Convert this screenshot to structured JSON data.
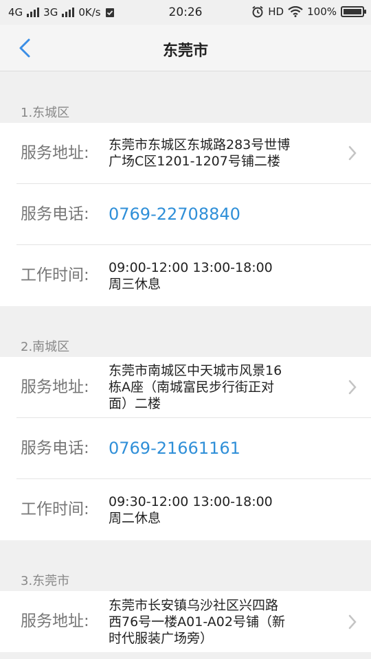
{
  "status_bar": {
    "signal_1": "4G",
    "signal_2": "3G",
    "speed": "0K/s",
    "time": "20:26",
    "hd": "HD",
    "battery": "100%"
  },
  "nav": {
    "title": "东莞市",
    "back_icon": "chevron-left-icon"
  },
  "sections": [
    {
      "heading": "1.东城区",
      "address_label": "服务地址:",
      "address_line1": "东莞市东城区东城路283号世博",
      "address_line2": "广场C区1201-1207号铺二楼",
      "phone_label": "服务电话:",
      "phone": "0769-22708840",
      "hours_label": "工作时间:",
      "hours_line1": "09:00-12:00 13:00-18:00",
      "hours_line2": "周三休息"
    },
    {
      "heading": "2.南城区",
      "address_label": "服务地址:",
      "address_line1": "东莞市南城区中天城市风景16",
      "address_line2": "栋A座（南城富民步行街正对",
      "address_line3": "面）二楼",
      "phone_label": "服务电话:",
      "phone": "0769-21661161",
      "hours_label": "工作时间:",
      "hours_line1": "09:30-12:00 13:00-18:00",
      "hours_line2": "周二休息"
    },
    {
      "heading": "3.东莞市",
      "address_label": "服务地址:",
      "address_line1": "东莞市长安镇乌沙社区兴四路",
      "address_line2": "西76号一楼A01-A02号铺（新",
      "address_line3": "时代服装广场旁）"
    }
  ],
  "colors": {
    "link": "#2f8fd8",
    "accent": "#3a8ee6",
    "background": "#f0f0f0"
  }
}
